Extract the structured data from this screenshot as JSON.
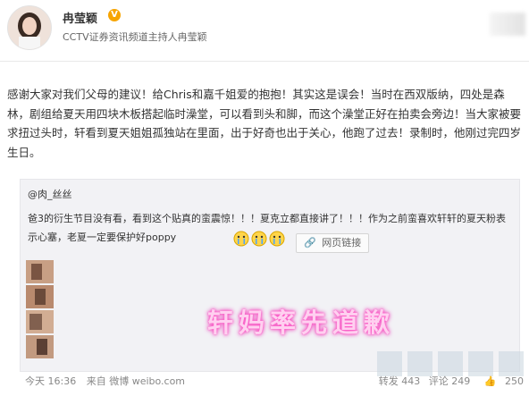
{
  "user": {
    "name": "冉莹颖",
    "verified_mark": "V",
    "description": "CCTV证券资讯频道主持人冉莹颖"
  },
  "post": {
    "text": "感谢大家对我们父母的建议！给Chris和嘉千姐爱的抱抱！其实这是误会！当时在西双版纳，四处是森林，剧组给夏天用四块木板搭起临时澡堂，可以看到头和脚，而这个澡堂正好在拍卖会旁边！当大家被要求扭过头时，轩看到夏天姐姐孤独站在里面，出于好奇也出于关心，他跑了过去！录制时，他刚过完四岁生日。"
  },
  "repost": {
    "author": "@肉_丝丝",
    "text": "爸3的衍生节目没有看，看到这个贴真的蛮震惊！！！夏克立都直接讲了！！！作为之前蛮喜欢轩轩的夏天粉表示心塞，老夏一定要保护好poppy",
    "link_label": "网页链接",
    "link_icon": "link-icon"
  },
  "overlay": {
    "stamp": "轩妈率先道歉"
  },
  "meta": {
    "time": "今天 16:36",
    "source": "来自 微博 weibo.com"
  },
  "actions": {
    "repost": "转发 443",
    "comment": "评论 249",
    "like": "250"
  },
  "colors": {
    "stamp_glow": "#ff5ec8",
    "verified": "#f7a400"
  }
}
